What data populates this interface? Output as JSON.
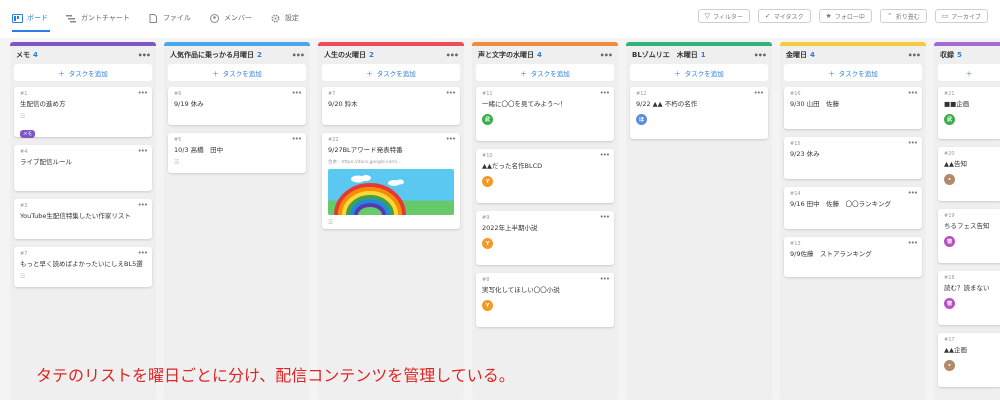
{
  "tabs": [
    {
      "label": "ボード",
      "icon": "board-icon",
      "active": true
    },
    {
      "label": "ガントチャート",
      "icon": "gantt-icon",
      "active": false
    },
    {
      "label": "ファイル",
      "icon": "file-icon",
      "active": false
    },
    {
      "label": "メンバー",
      "icon": "member-icon",
      "active": false
    },
    {
      "label": "設定",
      "icon": "gear-icon",
      "active": false
    }
  ],
  "actions": [
    {
      "label": "フィルター",
      "icon": "filter-icon"
    },
    {
      "label": "マイタスク",
      "icon": "check-icon"
    },
    {
      "label": "フォロー中",
      "icon": "star-icon"
    },
    {
      "label": "折り畳む",
      "icon": "collapse-icon"
    },
    {
      "label": "アーカイブ",
      "icon": "archive-icon"
    }
  ],
  "add_task_label": "タスクを追加",
  "columns": [
    {
      "title": "メモ",
      "count": "4",
      "color": "#7e57c2",
      "cards": [
        {
          "num": "#1",
          "title": "生配信の進め方",
          "chip": "メモ"
        },
        {
          "num": "#4",
          "title": "ライブ配信ルール"
        },
        {
          "num": "#3",
          "title": "YouTube生配信特集したい作家リスト"
        },
        {
          "num": "#7",
          "title": "もっと早く読めばよかったいにしえBL5選"
        }
      ]
    },
    {
      "title": "人気作品に乗っかる月曜日",
      "count": "2",
      "color": "#4aa8e8",
      "cards": [
        {
          "num": "#6",
          "title": "9/19 休み"
        },
        {
          "num": "#5",
          "title": "10/3 高橋　田中"
        }
      ]
    },
    {
      "title": "人生の火曜日",
      "count": "2",
      "color": "#ef4b5a",
      "cards": [
        {
          "num": "#7",
          "title": "9/20 鈴木"
        },
        {
          "num": "#22",
          "title": "9/27BLアワード発表特番",
          "sub": "台本：https://docs.google.com/..."
        }
      ]
    },
    {
      "title": "声と文字の水曜日",
      "count": "4",
      "color": "#f08a3c",
      "cards": [
        {
          "num": "#11",
          "title": "一緒に〇〇を見てみよう～！",
          "avatar": "武",
          "avatar_color": "#3aae4a"
        },
        {
          "num": "#10",
          "title": "▲▲だった名作BLCD",
          "avatar": "Y",
          "avatar_color": "#f29a25"
        },
        {
          "num": "#9",
          "title": "2022年上半期小説",
          "avatar": "Y",
          "avatar_color": "#f29a25"
        },
        {
          "num": "#8",
          "title": "実写化してほしい〇〇小説",
          "avatar": "Y",
          "avatar_color": "#f29a25"
        }
      ]
    },
    {
      "title": "BLゾムリエ　木曜日",
      "count": "1",
      "color": "#2fb37a",
      "cards": [
        {
          "num": "#12",
          "title": "9/22 ▲▲ 不朽の名作",
          "avatar": "ほ",
          "avatar_color": "#5b8dd6"
        }
      ]
    },
    {
      "title": "金曜日",
      "count": "4",
      "color": "#f3cb3d",
      "cards": [
        {
          "num": "#16",
          "title": "9/30 山田　佐藤"
        },
        {
          "num": "#15",
          "title": "9/23 休み"
        },
        {
          "num": "#14",
          "title": "9/16 田中　佐藤　〇〇ランキング"
        },
        {
          "num": "#13",
          "title": "9/9佐藤　ストアランキング"
        }
      ]
    },
    {
      "title": "収録",
      "count": "5",
      "color": "#a36ad6",
      "cards": [
        {
          "num": "#21",
          "title": "■■企画",
          "avatar": "武",
          "avatar_color": "#3aae4a"
        },
        {
          "num": "#20",
          "title": "▲▲告知",
          "avatar": "•",
          "avatar_color": "#b08a6a"
        },
        {
          "num": "#19",
          "title": "ちるフェス告知",
          "avatar": "徳",
          "avatar_color": "#b94fc0"
        },
        {
          "num": "#18",
          "title": "読む？読まない",
          "avatar": "徳",
          "avatar_color": "#b94fc0"
        },
        {
          "num": "#17",
          "title": "▲▲企画",
          "avatar": "•",
          "avatar_color": "#b08a6a"
        }
      ]
    }
  ],
  "caption": "タテのリストを曜日ごとに分け、配信コンテンツを管理している。"
}
